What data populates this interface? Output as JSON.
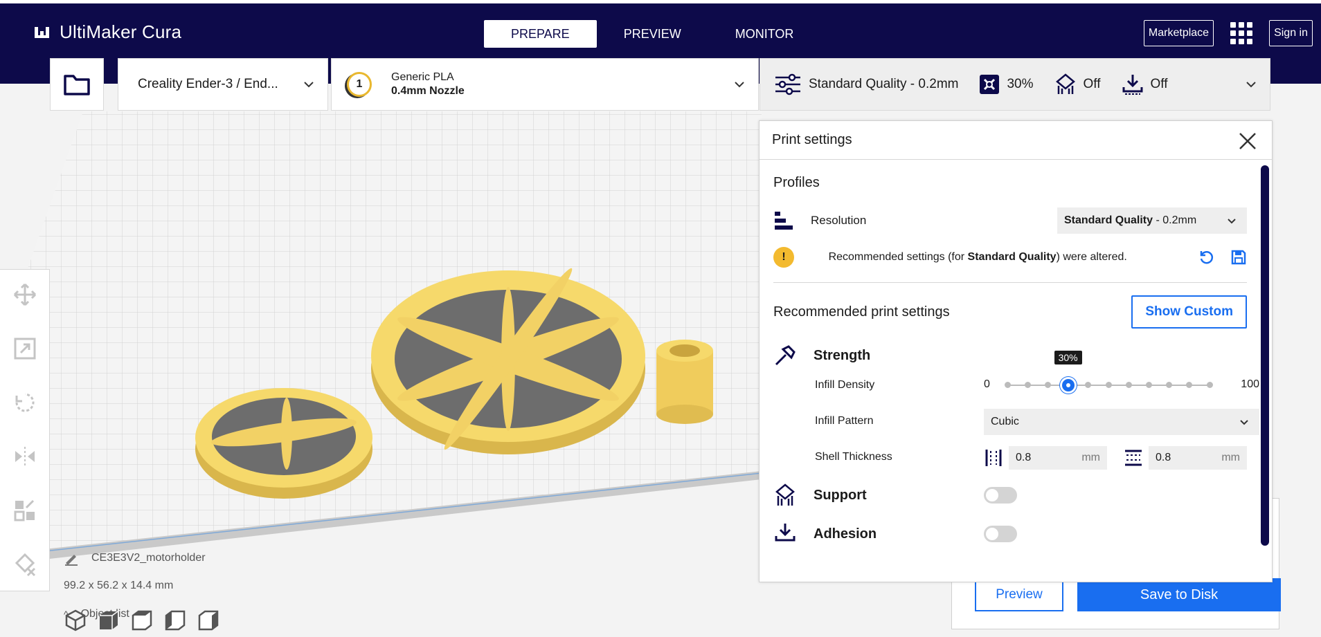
{
  "app": {
    "name": "UltiMaker Cura"
  },
  "nav": {
    "tabs": [
      {
        "label": "PREPARE",
        "active": true
      },
      {
        "label": "PREVIEW",
        "active": false
      },
      {
        "label": "MONITOR",
        "active": false
      }
    ],
    "marketplace_label": "Marketplace",
    "signin_label": "Sign in"
  },
  "header": {
    "printer": "Creality Ender-3 / End...",
    "material": {
      "name": "Generic PLA",
      "nozzle": "0.4mm Nozzle",
      "extruder_number": "1",
      "badge_color": "#e9b82f"
    },
    "profile": "Standard Quality - 0.2mm",
    "infill": "30%",
    "support": "Off",
    "adhesion": "Off"
  },
  "print_settings": {
    "title": "Print settings",
    "profiles_title": "Profiles",
    "resolution_label": "Resolution",
    "resolution_value_bold": "Standard Quality",
    "resolution_value_rest": " - 0.2mm",
    "warning_prefix": "Recommended settings (for ",
    "warning_bold": "Standard Quality",
    "warning_suffix": ") were altered.",
    "recommended_title": "Recommended print settings",
    "show_custom_label": "Show Custom",
    "strength_title": "Strength",
    "infill_density_label": "Infill Density",
    "infill_min": "0",
    "infill_max": "100",
    "infill_value_label": "30%",
    "infill_value": 30,
    "infill_pattern_label": "Infill Pattern",
    "infill_pattern_value": "Cubic",
    "shell_thickness_label": "Shell Thickness",
    "wall_thickness": "0.8",
    "top_bottom_thickness": "0.8",
    "unit_mm": "mm",
    "support_title": "Support",
    "support_enabled": false,
    "adhesion_title": "Adhesion",
    "adhesion_enabled": false
  },
  "objects": {
    "list_label": "Object list",
    "name": "CE3E3V2_motorholder",
    "dimensions": "99.2 x 56.2 x 14.4 mm"
  },
  "actions": {
    "preview_label": "Preview",
    "save_label": "Save to Disk"
  },
  "colors": {
    "navy": "#0d0a4a",
    "accent_blue": "#196ef0",
    "model_yellow": "#f6d96b",
    "warning_yellow": "#f3ba2f"
  }
}
